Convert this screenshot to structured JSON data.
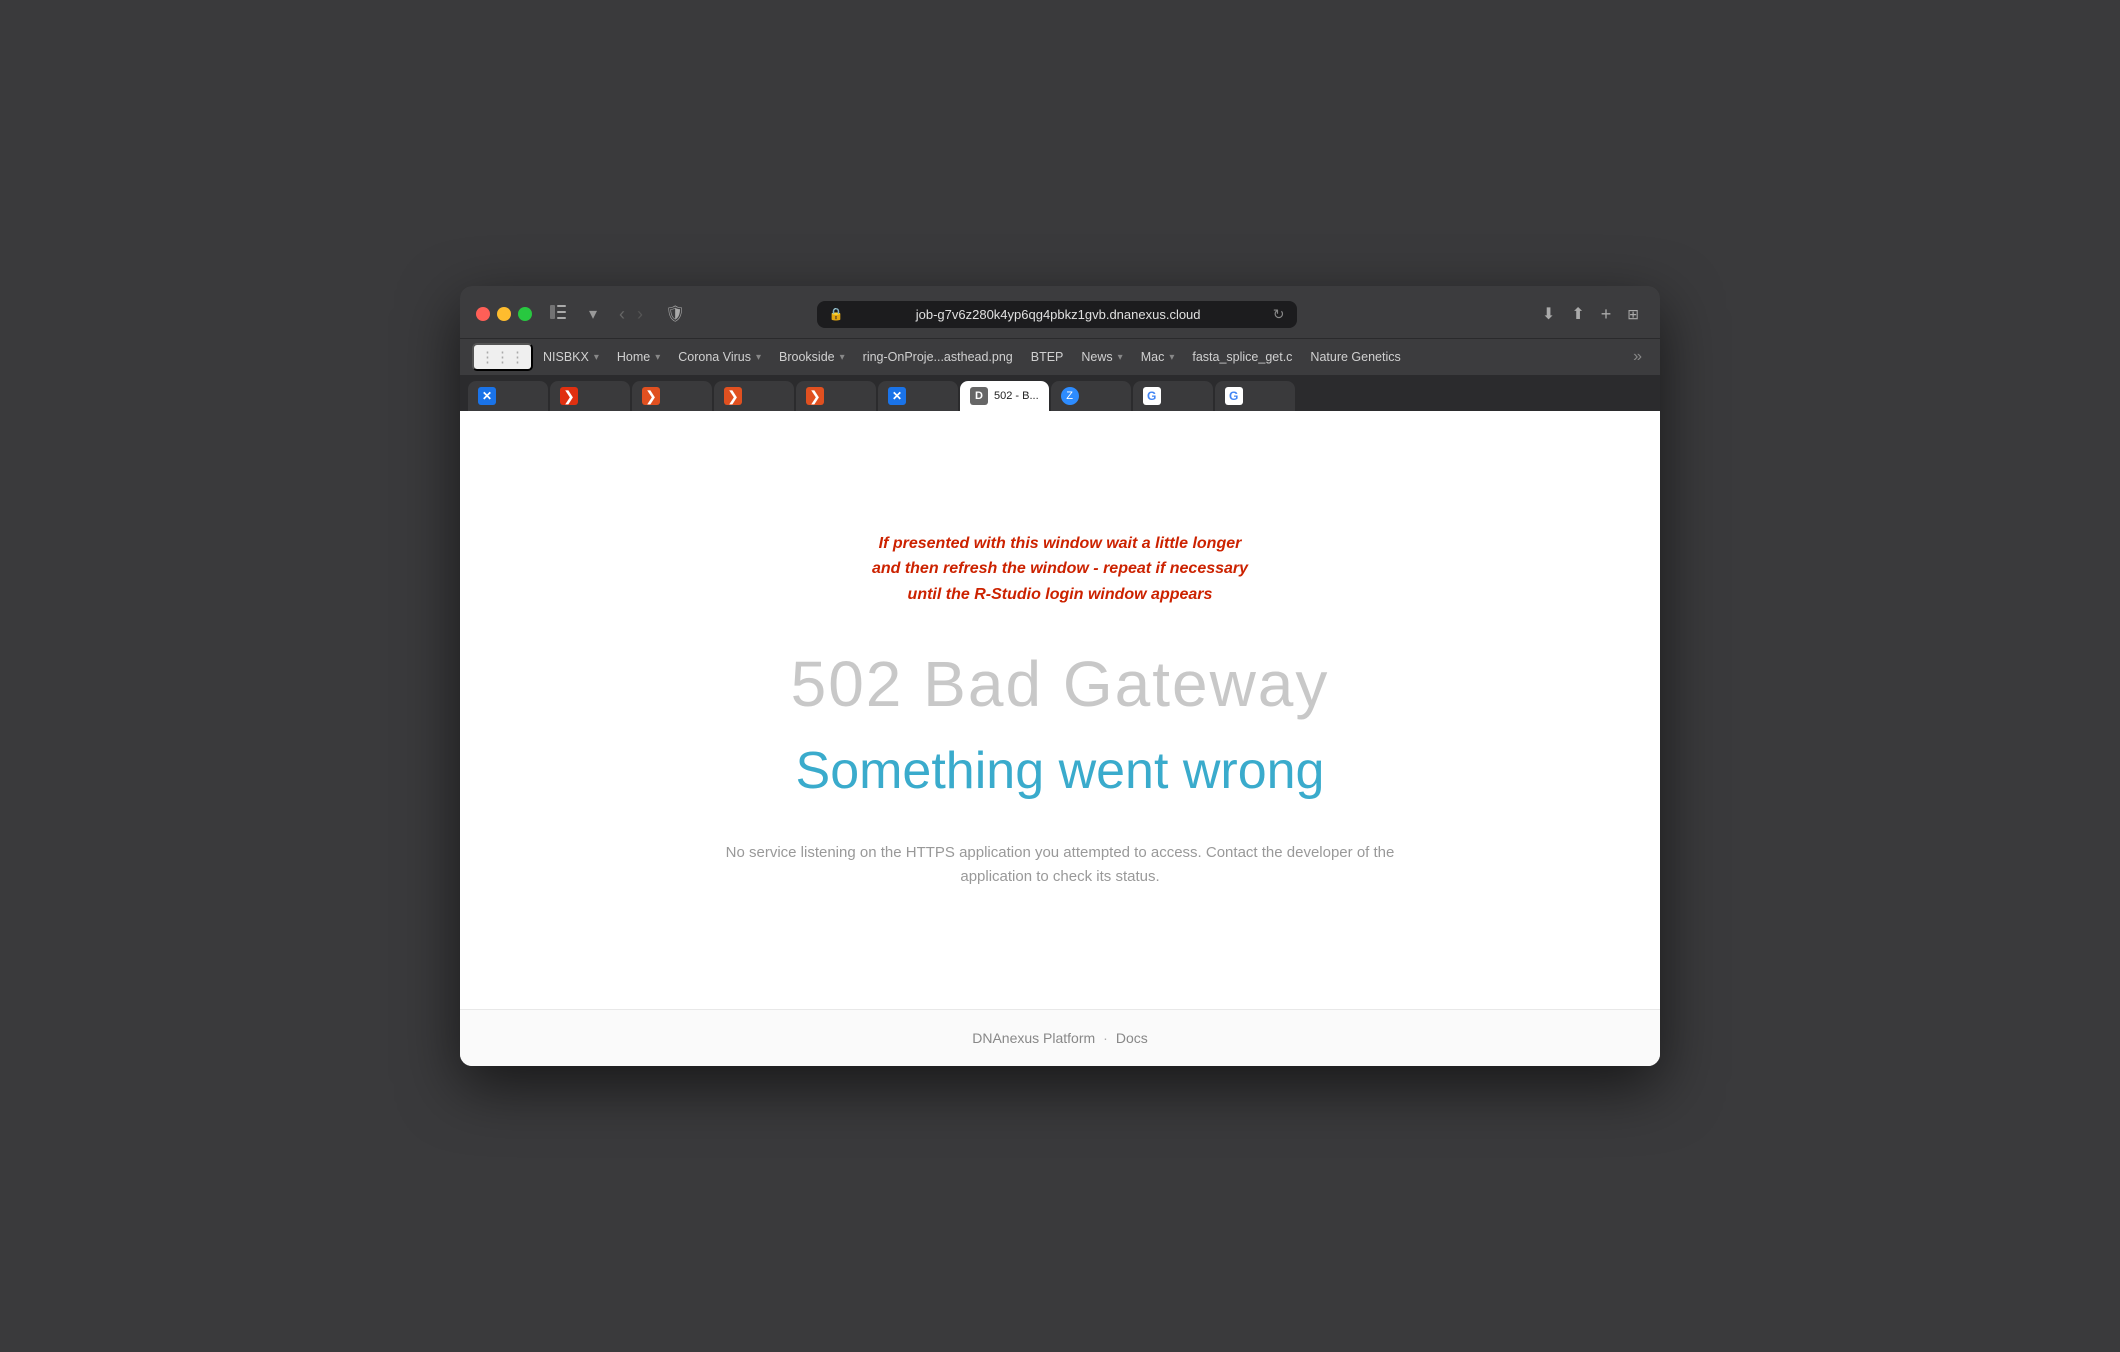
{
  "browser": {
    "url": "job-g7v6z280k4yp6qg4pbkz1gvb.dnanexus.cloud",
    "reload_title": "Reload"
  },
  "bookmarks": {
    "items": [
      {
        "id": "nisbkx",
        "label": "NISBKX",
        "has_dropdown": true
      },
      {
        "id": "home",
        "label": "Home",
        "has_dropdown": true
      },
      {
        "id": "corona-virus",
        "label": "Corona Virus",
        "has_dropdown": true
      },
      {
        "id": "brookside",
        "label": "Brookside",
        "has_dropdown": true
      },
      {
        "id": "ring-project",
        "label": "ring-OnProje...asthead.png",
        "has_dropdown": false
      },
      {
        "id": "btep",
        "label": "BTEP",
        "has_dropdown": false
      },
      {
        "id": "news",
        "label": "News",
        "has_dropdown": true
      },
      {
        "id": "mac",
        "label": "Mac",
        "has_dropdown": true
      },
      {
        "id": "fasta-splice",
        "label": "fasta_splice_get.c",
        "has_dropdown": false
      },
      {
        "id": "nature-genetics",
        "label": "Nature Genetics",
        "has_dropdown": false
      }
    ]
  },
  "tabs": [
    {
      "id": "tab1",
      "label": "X",
      "favicon_type": "favicon-x",
      "active": false
    },
    {
      "id": "tab2",
      "label": "",
      "favicon_type": "favicon-arrow",
      "active": false
    },
    {
      "id": "tab3",
      "label": "",
      "favicon_type": "favicon-arrow2",
      "active": false
    },
    {
      "id": "tab4",
      "label": "",
      "favicon_type": "favicon-arrow2",
      "active": false
    },
    {
      "id": "tab5",
      "label": "",
      "favicon_type": "favicon-arrow2",
      "active": false
    },
    {
      "id": "tab6",
      "label": "X",
      "favicon_type": "favicon-x",
      "active": false
    },
    {
      "id": "tab7",
      "label": "502 - B...",
      "favicon_type": "favicon-d",
      "active": true
    },
    {
      "id": "tab8",
      "label": "",
      "favicon_type": "favicon-zoom",
      "active": false
    },
    {
      "id": "tab9",
      "label": "G",
      "favicon_type": "favicon-g",
      "active": false
    },
    {
      "id": "tab10",
      "label": "",
      "favicon_type": "favicon-google",
      "active": false
    }
  ],
  "page": {
    "warning_line1": "If presented with this window wait a little longer",
    "warning_line2": "and then refresh the window - repeat if necessary",
    "warning_line3": "until the R-Studio login window appears",
    "error_code": "502 Bad Gateway",
    "error_title": "Something went wrong",
    "error_description": "No service listening on the HTTPS application you attempted to access. Contact the developer of the application to check its status."
  },
  "footer": {
    "platform_text": "DNAnexus Platform",
    "separator": "·",
    "docs_text": "Docs"
  }
}
